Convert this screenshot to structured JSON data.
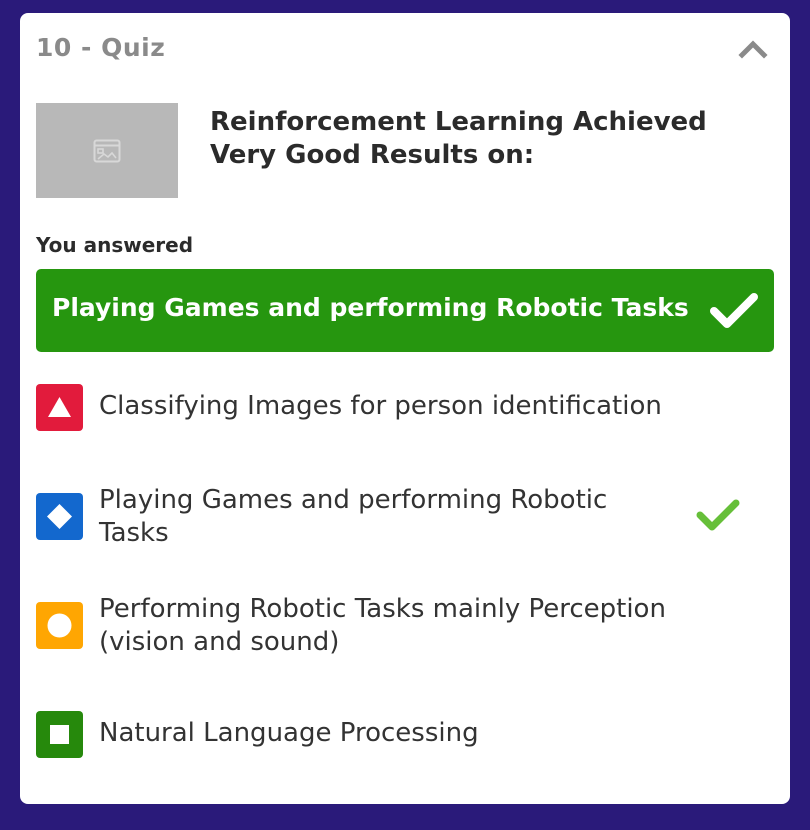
{
  "quiz": {
    "title": "10 - Quiz",
    "collapse_icon": "chevron-up-icon",
    "question": {
      "image_icon": "image-placeholder-icon",
      "text": "Reinforcement Learning Achieved Very Good Results on:"
    },
    "answered_label": "You answered",
    "answered": {
      "text": "Playing Games and performing Robotic Tasks",
      "status_icon": "checkmark-icon",
      "color": "#26960f"
    },
    "options": [
      {
        "label": "Classifying Images for person identification",
        "shape": "triangle",
        "color": "#e21b3c",
        "correct": false
      },
      {
        "label": "Playing Games and performing Robotic Tasks",
        "shape": "diamond",
        "color": "#1368ce",
        "correct": true
      },
      {
        "label": "Performing Robotic Tasks mainly Perception (vision and sound)",
        "shape": "circle",
        "color": "#ffa602",
        "correct": false
      },
      {
        "label": "Natural Language Processing",
        "shape": "square",
        "color": "#26890c",
        "correct": false
      }
    ],
    "correct_mark_color": "#66bf39"
  }
}
